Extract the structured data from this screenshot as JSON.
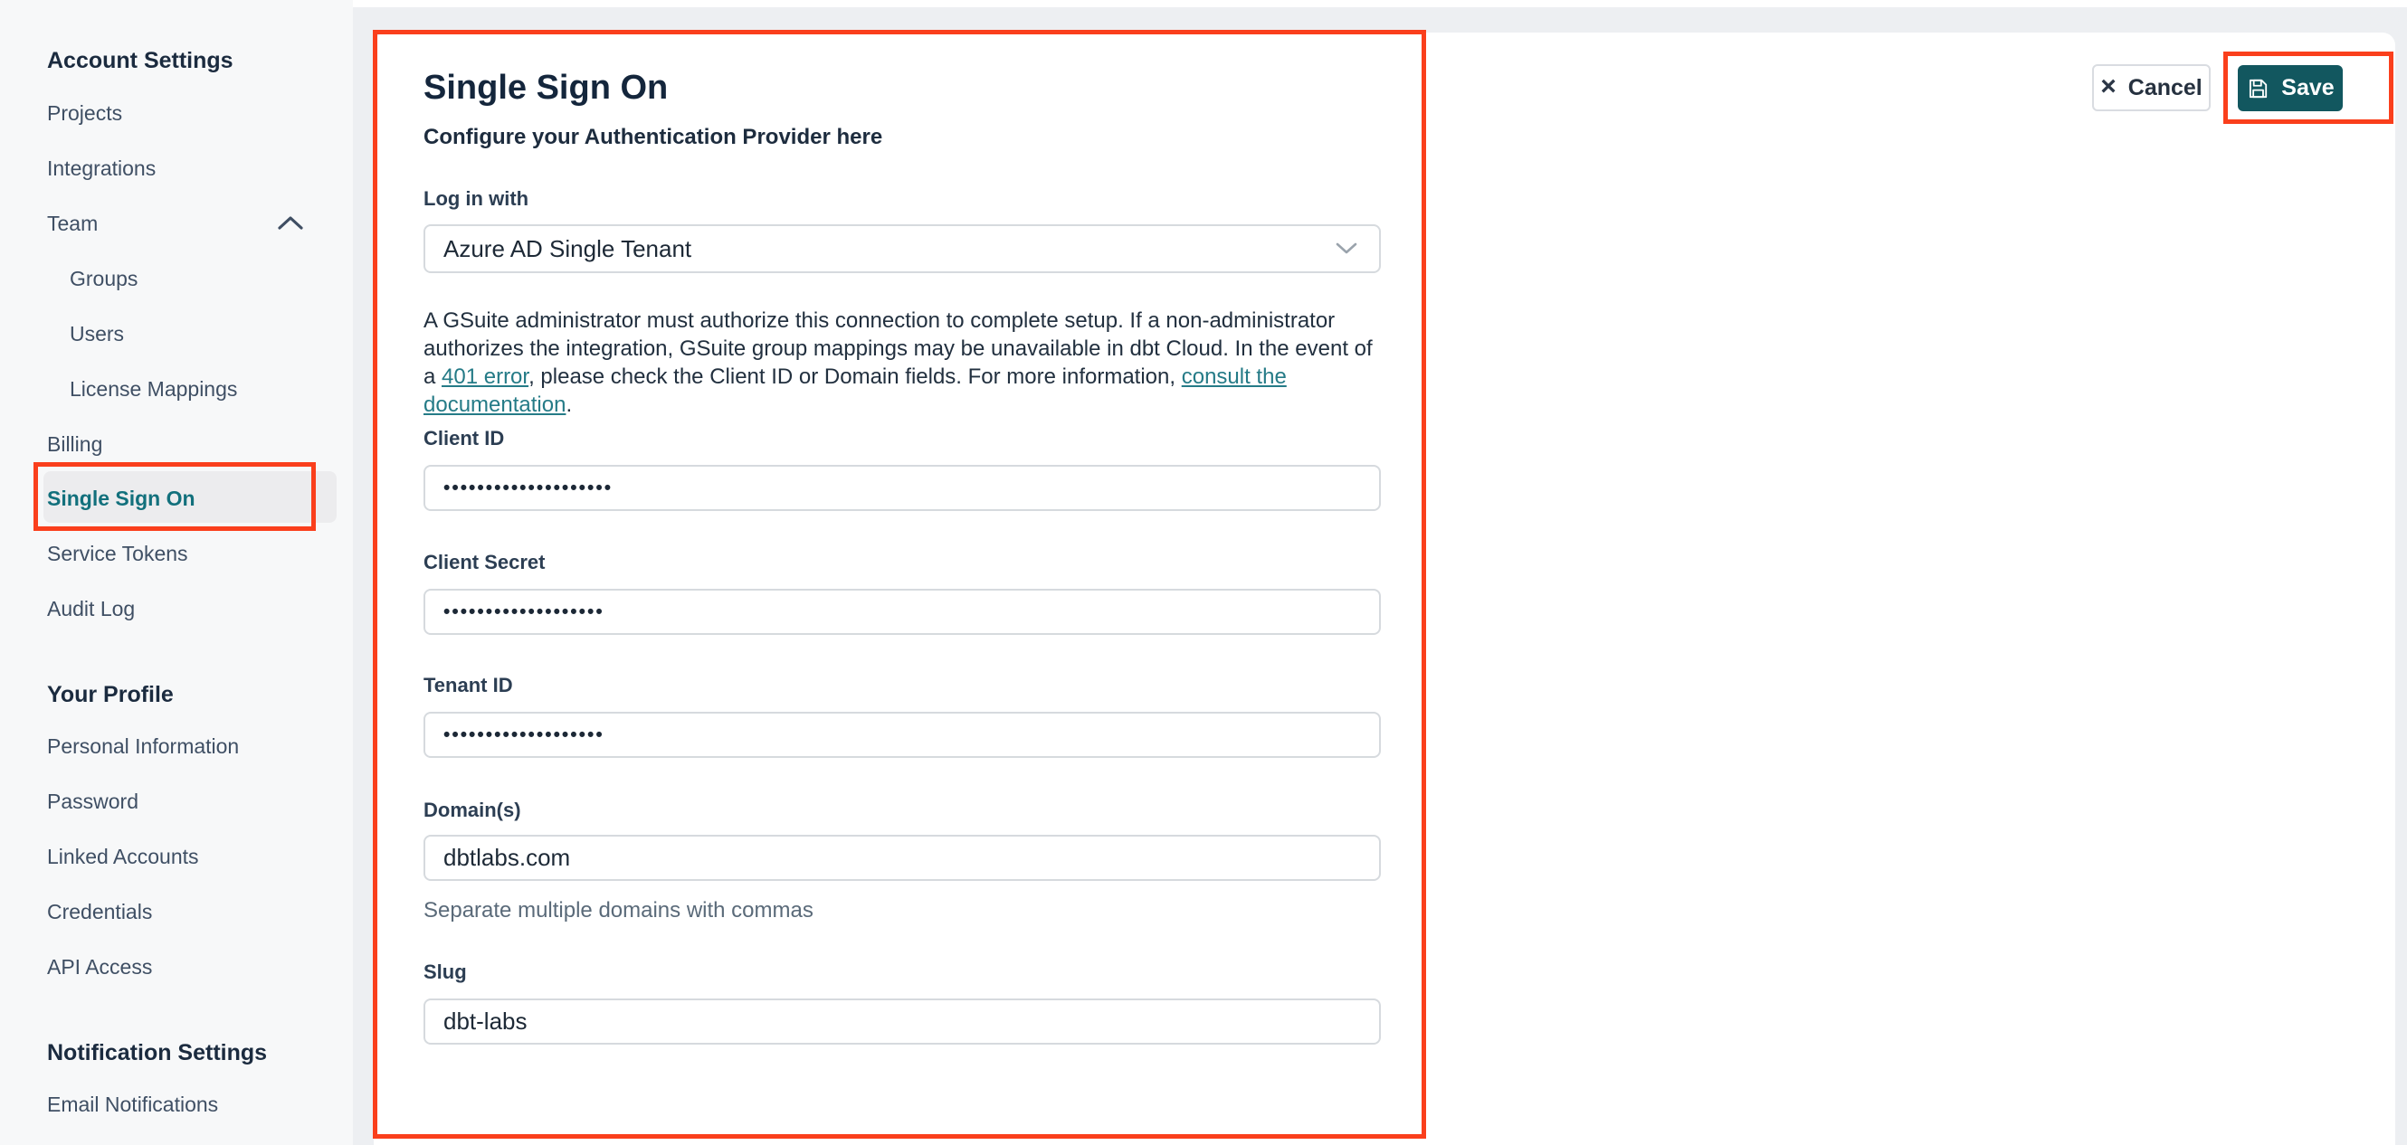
{
  "sidebar": {
    "sections": [
      {
        "title": "Account Settings",
        "items": [
          "Projects",
          "Integrations",
          "Team",
          "Groups",
          "Users",
          "License Mappings",
          "Billing",
          "Single Sign On",
          "Service Tokens",
          "Audit Log"
        ]
      },
      {
        "title": "Your Profile",
        "items": [
          "Personal Information",
          "Password",
          "Linked Accounts",
          "Credentials",
          "API Access"
        ]
      },
      {
        "title": "Notification Settings",
        "items": [
          "Email Notifications"
        ]
      }
    ]
  },
  "main": {
    "title": "Single Sign On",
    "subtitle": "Configure your Authentication Provider here",
    "actions": {
      "cancel": "Cancel",
      "save": "Save"
    },
    "form": {
      "login_with": {
        "label": "Log in with",
        "value": "Azure AD Single Tenant"
      },
      "info": {
        "part1": "A GSuite administrator must authorize this connection to complete setup. If a non-administrator authorizes the integration, GSuite group mappings may be unavailable in dbt Cloud. In the event of a ",
        "link1": "401 error",
        "part2": ", please check the Client ID or Domain fields. For more information, ",
        "link2": "consult the documentation",
        "part3": "."
      },
      "client_id": {
        "label": "Client ID",
        "value": "••••••••••••••••••••"
      },
      "client_secret": {
        "label": "Client Secret",
        "value": "•••••••••••••••••••"
      },
      "tenant_id": {
        "label": "Tenant ID",
        "value": "•••••••••••••••••••"
      },
      "domains": {
        "label": "Domain(s)",
        "value": "dbtlabs.com",
        "help": "Separate multiple domains with commas"
      },
      "slug": {
        "label": "Slug",
        "value": "dbt-labs"
      }
    }
  },
  "colors": {
    "annotation_red": "#fa3f1c",
    "primary_teal": "#12575f",
    "link_teal": "#257b87",
    "active_item_teal": "#12707c",
    "sidebar_bg": "#f7f8f9",
    "page_bg": "#edeff2"
  }
}
